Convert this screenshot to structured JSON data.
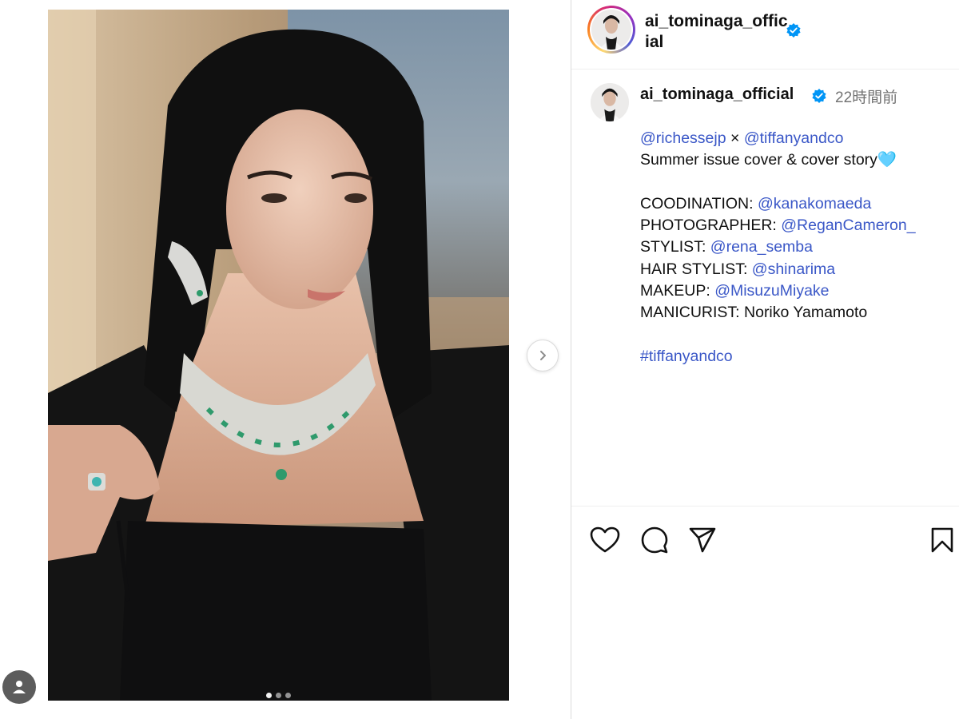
{
  "post": {
    "username": "ai_tominaga_official",
    "header_username_wrapped": "ai_tominaga_official",
    "verified_icon": "verified-badge-icon",
    "timestamp": "22時間前",
    "carousel": {
      "total": 3,
      "active_index": 1
    }
  },
  "caption": {
    "line1": {
      "mention_a": "@richessejp",
      "sep": " × ",
      "mention_b": "@tiffanyandco"
    },
    "line2": {
      "text": "Summer issue cover & cover story",
      "emoji": "🩵"
    },
    "credits": [
      {
        "label": "COODINATION: ",
        "mention": "@kanakomaeda"
      },
      {
        "label": "PHOTOGRAPHER: ",
        "mention": "@ReganCameron_"
      },
      {
        "label": "STYLIST: ",
        "mention": "@rena_semba"
      },
      {
        "label": "HAIR STYLIST: ",
        "mention": "@shinarima"
      },
      {
        "label": "MAKEUP: ",
        "mention": "@MisuzuMiyake"
      },
      {
        "label": "MANICURIST: ",
        "text": "Noriko Yamamoto"
      }
    ],
    "hashtag": "#tiffanyandco"
  },
  "icons": {
    "like": "heart-icon",
    "comment": "comment-bubble-icon",
    "share": "paper-plane-icon",
    "save": "bookmark-icon",
    "next": "chevron-right-icon",
    "profile": "person-icon"
  },
  "colors": {
    "link": "#3a57c7",
    "verified": "#0095f6",
    "muted": "#737373",
    "border": "#dbdbdb"
  }
}
